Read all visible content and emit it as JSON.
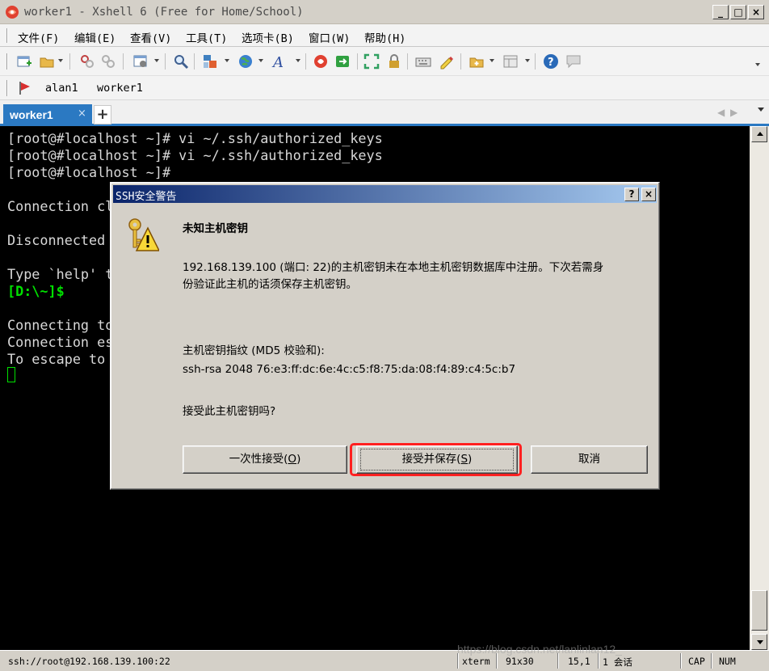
{
  "window": {
    "title": "worker1 - Xshell 6 (Free for Home/School)",
    "controls": [
      "_",
      "□",
      "×"
    ]
  },
  "menubar": {
    "items": [
      "文件(F)",
      "编辑(E)",
      "查看(V)",
      "工具(T)",
      "选项卡(B)",
      "窗口(W)",
      "帮助(H)"
    ]
  },
  "toolbar": {
    "icons": [
      "new-session-icon",
      "open-folder-icon",
      "reconnect-icon",
      "disconnect-icon",
      "properties-icon",
      "find-icon",
      "layout-icon",
      "globe-icon",
      "font-icon",
      "xshell-icon",
      "xftp-icon",
      "fullscreen-icon",
      "lock-icon",
      "keyboard-icon",
      "highlight-icon",
      "new-tab-icon",
      "tab-layout-icon",
      "help-icon",
      "chat-icon"
    ]
  },
  "links": {
    "items": [
      "alan1",
      "worker1"
    ]
  },
  "tabs": {
    "active_label": "worker1",
    "close": "×",
    "add": "+",
    "nav_left": "◀",
    "nav_right": "▶"
  },
  "terminal": {
    "lines": [
      "[root@#localhost ~]# vi ~/.ssh/authorized_keys",
      "[root@#localhost ~]# vi ~/.ssh/authorized_keys",
      "[root@#localhost ~]#",
      "",
      "Connection cl",
      "",
      "Disconnected",
      "",
      "Type `help' t",
      "[D:\\~]$",
      "",
      "Connecting to",
      "Connection es",
      "To escape to"
    ]
  },
  "dialog": {
    "title": "SSH安全警告",
    "help_btn": "?",
    "close_btn": "×",
    "heading": "未知主机密钥",
    "message_line1": "192.168.139.100 (端口: 22)的主机密钥未在本地主机密钥数据库中注册。下次若需身",
    "message_line2": "份验证此主机的话须保存主机密钥。",
    "fingerprint_label": "主机密钥指纹 (MD5 校验和):",
    "fingerprint": "ssh-rsa 2048 76:e3:ff:dc:6e:4c:c5:f8:75:da:08:f4:89:c4:5c:b7",
    "question": "接受此主机密钥吗?",
    "btn_once_text": "一次性接受(",
    "btn_once_key": "O",
    "btn_once_end": ")",
    "btn_save_text": "接受并保存(",
    "btn_save_key": "S",
    "btn_save_end": ")",
    "btn_cancel": "取消"
  },
  "statusbar": {
    "connection": "ssh://root@192.168.139.100:22",
    "term": "xterm",
    "size": "91x30",
    "cursor": "15,1",
    "sessions": "1 会话",
    "cap": "CAP",
    "num": "NUM"
  },
  "watermark": "https://blog.csdn.net/lanlinlan12_",
  "colors": {
    "accent": "#2b79c2",
    "terminal_bg": "#000000",
    "terminal_fg": "#d8d8d8",
    "prompt_green": "#00e000",
    "dialog_title": "#0a246a",
    "highlight_red": "#ff2020"
  }
}
